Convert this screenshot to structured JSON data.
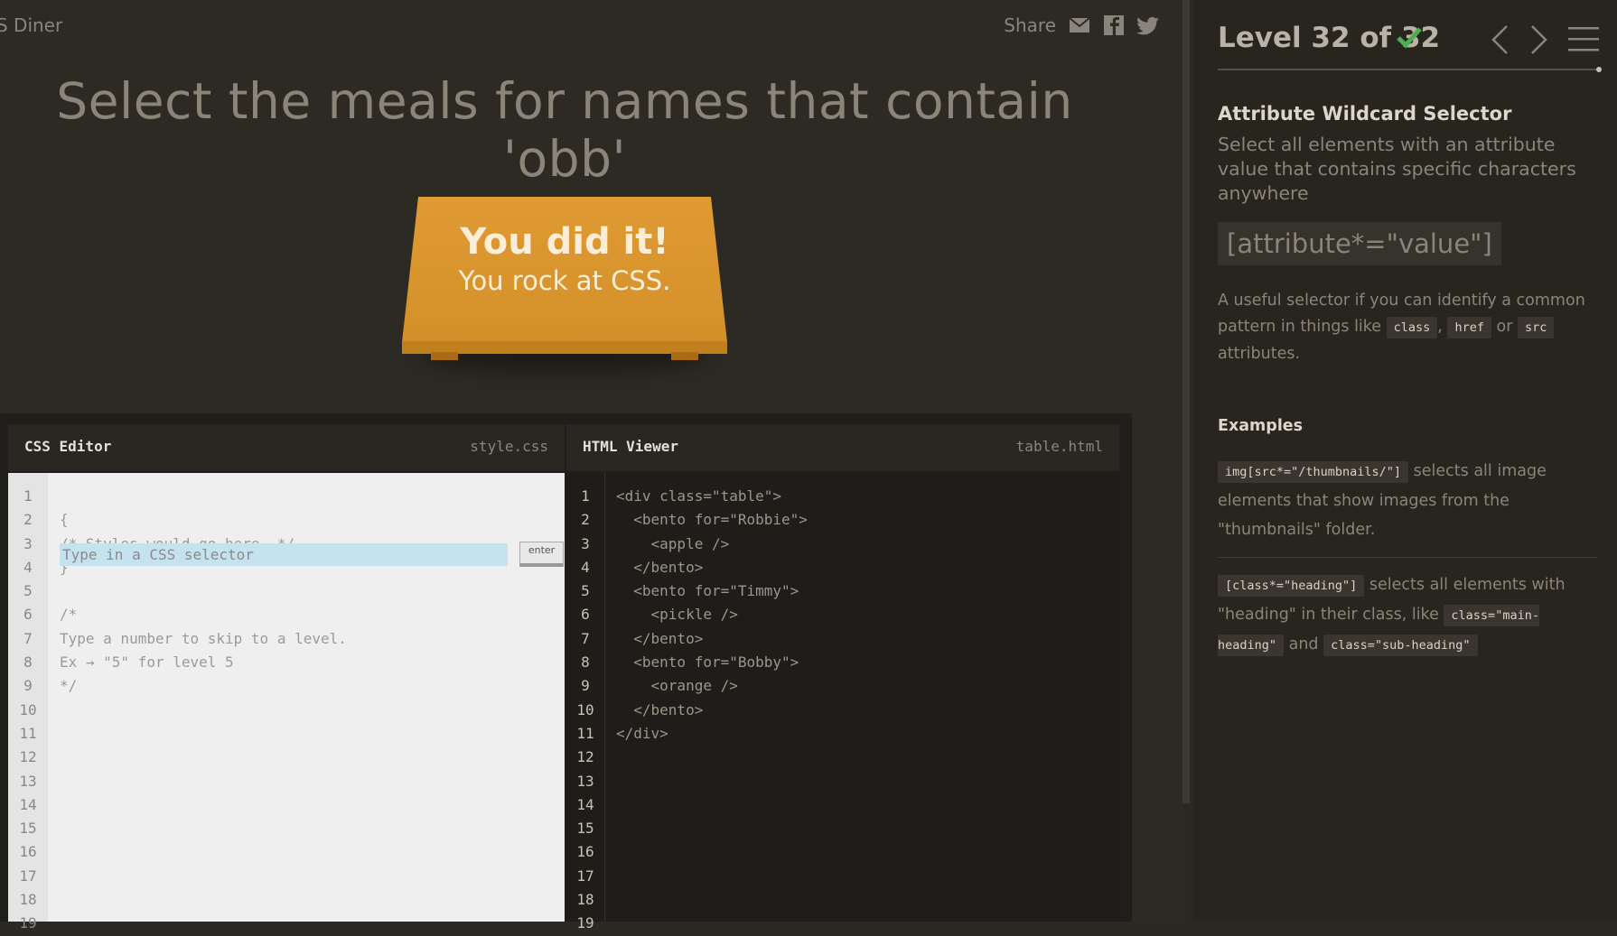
{
  "game": {
    "logo": "S Diner",
    "share_label": "Share",
    "share_icons": [
      "mail-icon",
      "facebook-icon",
      "twitter-icon"
    ],
    "instruction": "Select the meals for names that contain 'obb'",
    "win_title": "You did it!",
    "win_subtitle": "You rock at CSS."
  },
  "css_editor": {
    "title": "CSS Editor",
    "file": "style.css",
    "input_placeholder": "Type in a CSS selector",
    "enter_label": "enter",
    "lines": [
      "",
      "{",
      "/* Styles would go here. */",
      "}",
      "",
      "/*",
      "Type a number to skip to a level.",
      "Ex → \"5\" for level 5",
      "*/"
    ],
    "line_numbers": [
      "1",
      "2",
      "3",
      "4",
      "5",
      "6",
      "7",
      "8",
      "9",
      "10",
      "11",
      "12",
      "13",
      "14",
      "15",
      "16",
      "17",
      "18",
      "19"
    ]
  },
  "html_viewer": {
    "title": "HTML Viewer",
    "file": "table.html",
    "lines": [
      "<div class=\"table\">",
      "  <bento for=\"Robbie\">",
      "    <apple />",
      "  </bento>",
      "  <bento for=\"Timmy\">",
      "    <pickle />",
      "  </bento>",
      "  <bento for=\"Bobby\">",
      "    <orange />",
      "  </bento>",
      "</div>"
    ],
    "line_numbers": [
      "1",
      "2",
      "3",
      "4",
      "5",
      "6",
      "7",
      "8",
      "9",
      "10",
      "11",
      "12",
      "13",
      "14",
      "15",
      "16",
      "17",
      "18",
      "19"
    ]
  },
  "sidebar": {
    "level_label": "Level 32 of 32",
    "level_complete": true,
    "selector_name": "Attribute Wildcard Selector",
    "selector_title": "Select all elements with an attribute value that contains specific characters anywhere",
    "syntax": "[attribute*=\"value\"]",
    "hint_pre": "A useful selector if you can identify a common pattern in things like",
    "hint_code_1": "class",
    "hint_sep_1": ",",
    "hint_code_2": "href",
    "hint_sep_2": "or",
    "hint_code_3": "src",
    "hint_post": "attributes.",
    "examples_title": "Examples",
    "example_1_code": "img[src*=\"/thumbnails/\"]",
    "example_1_text": "selects all image elements that show images from the \"thumbnails\" folder.",
    "example_2_code": "[class*=\"heading\"]",
    "example_2_text": "selects all elements with \"heading\" in their class, like",
    "example_2_code_b": "class=\"main-heading\"",
    "example_2_and": "and",
    "example_2_code_c": "class=\"sub-heading\""
  },
  "colors": {
    "accent_check": "#4caf50",
    "table": "#d99430",
    "input_highlight": "#c5e2ef"
  }
}
